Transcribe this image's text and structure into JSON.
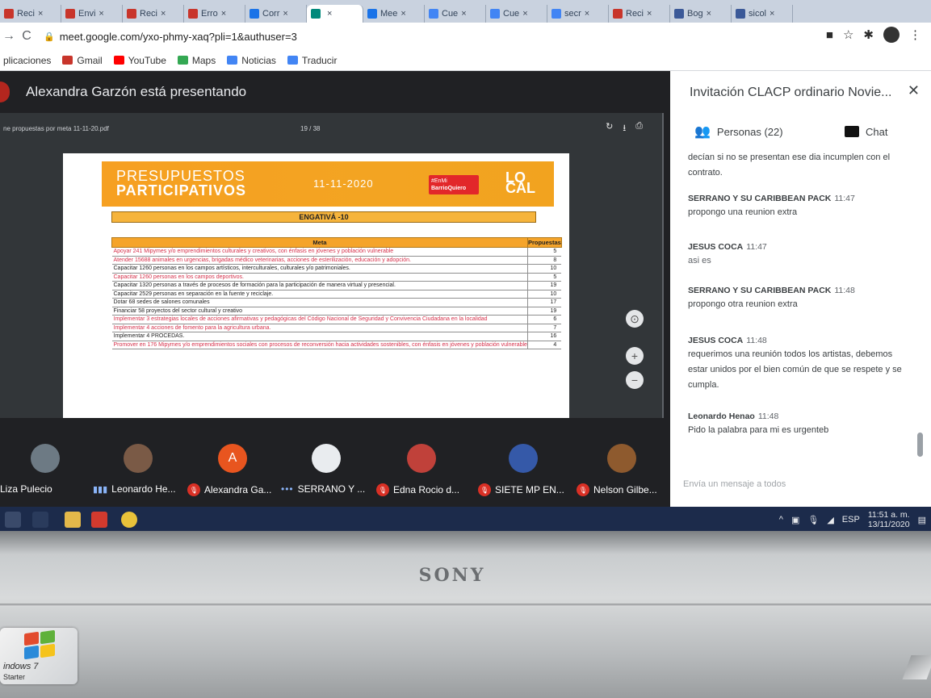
{
  "browser": {
    "tabs": [
      {
        "label": "Reci",
        "fav": "#c8352b"
      },
      {
        "label": "Envi",
        "fav": "#c8352b"
      },
      {
        "label": "Reci",
        "fav": "#c8352b"
      },
      {
        "label": "Erro",
        "fav": "#c8352b"
      },
      {
        "label": "Corr",
        "fav": "#1a73e8"
      },
      {
        "label": "",
        "fav": "#00897b",
        "active": true
      },
      {
        "label": "Mee",
        "fav": "#1a73e8"
      },
      {
        "label": "Cue",
        "fav": "#4285f4"
      },
      {
        "label": "Cue",
        "fav": "#4285f4"
      },
      {
        "label": "secr",
        "fav": "#4285f4"
      },
      {
        "label": "Reci",
        "fav": "#c8352b"
      },
      {
        "label": "Bog",
        "fav": "#3b5998"
      },
      {
        "label": "sicol",
        "fav": "#3b5998"
      }
    ],
    "url": "meet.google.com/yxo-phmy-xaq?pli=1&authuser=3",
    "bookmarks": [
      {
        "label": "plicaciones",
        "icon": "apps-icon",
        "color": "#4285f4"
      },
      {
        "label": "Gmail",
        "icon": "gmail-icon",
        "color": "#c8352b"
      },
      {
        "label": "YouTube",
        "icon": "youtube-icon",
        "color": "#ff0000"
      },
      {
        "label": "Maps",
        "icon": "maps-icon",
        "color": "#34a853"
      },
      {
        "label": "Noticias",
        "icon": "news-icon",
        "color": "#4285f4"
      },
      {
        "label": "Traducir",
        "icon": "translate-icon",
        "color": "#4285f4"
      }
    ]
  },
  "meet": {
    "presenter_text": "Alexandra Garzón está presentando",
    "pdf": {
      "filename": "ne propuestas por meta 11-11-20.pdf",
      "page_indicator": "19 / 38",
      "header_title_1": "PRESUPUESTOS",
      "header_title_2": "PARTICIPATIVOS",
      "header_date": "11-11-2020",
      "badge_1": "#EnMi",
      "badge_2": "BarrioQuiero",
      "logo_1": "LO",
      "logo_2": "CAL",
      "locality": "ENGATIVÁ -10",
      "col_meta": "Meta",
      "col_prop": "Propuestas",
      "rows": [
        {
          "meta": "Apoyar 241 Mipymes y/o emprendimientos culturales y creativos, con énfasis en jóvenes y población vulnerable",
          "prop": "5",
          "red": true
        },
        {
          "meta": "Atender 15688 animales en urgencias, brigadas médico veterinarias, acciones de esterilización, educación y adopción.",
          "prop": "8",
          "red": true
        },
        {
          "meta": "Capacitar 1260 personas en los campos artísticos, interculturales, culturales y/o patrimoniales.",
          "prop": "10",
          "red": false
        },
        {
          "meta": "Capacitar 1260 personas en los campos deportivos.",
          "prop": "5",
          "red": true
        },
        {
          "meta": "Capacitar 1320 personas a través de procesos de formación para la participación de manera virtual y presencial.",
          "prop": "19",
          "red": false
        },
        {
          "meta": "Capacitar 2529 personas en separación en la fuente y reciclaje.",
          "prop": "10",
          "red": false
        },
        {
          "meta": "Dotar 68 sedes de salones comunales",
          "prop": "17",
          "red": false
        },
        {
          "meta": "Financiar 58 proyectos del sector cultural y creativo",
          "prop": "19",
          "red": false
        },
        {
          "meta": "Implementar 3 estrategias locales de acciones afirmativas y pedagógicas del Código Nacional de Seguridad y Convivencia Ciudadana en la localidad",
          "prop": "6",
          "red": true
        },
        {
          "meta": "Implementar 4 acciones de fomento para la agricultura urbana.",
          "prop": "7",
          "red": true
        },
        {
          "meta": "Implementar 4 PROCEDAS.",
          "prop": "16",
          "red": false
        },
        {
          "meta": "Promover en 176 Mipymes y/o emprendimientos sociales con procesos de reconversión hacia actividades sostenibles, con énfasis en jóvenes y población vulnerable",
          "prop": "4",
          "red": true
        }
      ]
    },
    "participants": [
      {
        "name": "Liza Pulecio",
        "status": "none",
        "avatar_color": "#6d7a84",
        "initial": ""
      },
      {
        "name": "Leonardo He...",
        "status": "speaking",
        "avatar_color": "#7a5a46",
        "initial": ""
      },
      {
        "name": "Alexandra Ga...",
        "status": "muted",
        "avatar_color": "#e8551f",
        "initial": "A"
      },
      {
        "name": "SERRANO Y ...",
        "status": "more",
        "avatar_color": "#e9ecef",
        "initial": ""
      },
      {
        "name": "Edna Rocio d...",
        "status": "muted",
        "avatar_color": "#c0413a",
        "initial": ""
      },
      {
        "name": "SIETE MP EN...",
        "status": "muted",
        "avatar_color": "#3559a8",
        "initial": ""
      },
      {
        "name": "Nelson Gilbe...",
        "status": "muted",
        "avatar_color": "#8e5a2e",
        "initial": ""
      }
    ]
  },
  "panel": {
    "title": "Invitación CLACP ordinario Novie...",
    "tab_people": "Personas (22)",
    "tab_chat": "Chat",
    "messages": [
      {
        "who": "",
        "time": "",
        "text": "decían si no se presentan ese dia incumplen con el contrato.",
        "muted": false
      },
      {
        "who": "SERRANO Y SU CARIBBEAN PACK",
        "time": "11:47",
        "text": "propongo una reunion extra",
        "muted": false
      },
      {
        "who": "JESUS COCA",
        "time": "11:47",
        "text": "asi es",
        "muted": true
      },
      {
        "who": "SERRANO Y SU CARIBBEAN PACK",
        "time": "11:48",
        "text": "propongo otra reunion extra",
        "muted": false
      },
      {
        "who": "JESUS COCA",
        "time": "11:48",
        "text": "requerimos una reunión todos los artistas, debemos estar unidos por el bien común de que se respete y se cumpla.",
        "muted": false
      },
      {
        "who": "Leonardo Henao",
        "time": "11:48",
        "text": "Pido la palabra para mi es urgenteb",
        "muted": false
      }
    ],
    "input_placeholder": "Envía un mensaje a todos"
  },
  "taskbar": {
    "lang": "ESP",
    "time": "11:51 a. m.",
    "date": "13/11/2020"
  },
  "laptop": {
    "brand": "SONY",
    "sticker_1": "indows 7",
    "sticker_2": "Starter"
  }
}
